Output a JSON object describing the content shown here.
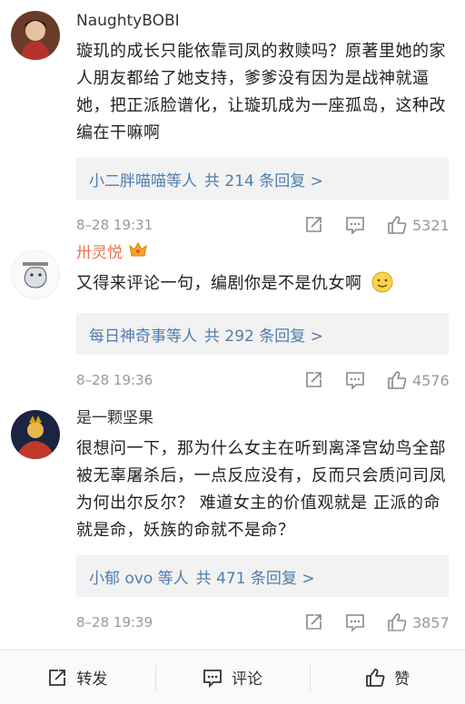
{
  "comments": [
    {
      "username": "NaughtyBOBI",
      "text": "璇玑的成长只能依靠司凤的救赎吗？原著里她的家人朋友都给了她支持，爹爹没有因为是战神就逼她，把正派脸谱化，让璇玑成为一座孤岛，这种改编在干嘛啊",
      "replies_who": "小二胖喵喵等人",
      "replies_count": "共 214 条回复 >",
      "date": "8–28 19:31",
      "likes": "5321"
    },
    {
      "username": "卅灵悦",
      "text": "又得来评论一句，编剧你是不是仇女啊",
      "replies_who": "每日神奇事等人",
      "replies_count": "共 292 条回复 >",
      "date": "8–28 19:36",
      "likes": "4576"
    },
    {
      "username": "是一颗坚果",
      "text": "很想问一下，那为什么女主在听到离泽宫幼鸟全部被无辜屠杀后，一点反应没有，反而只会质问司凤为何出尔反尔？ 难道女主的价值观就是 正派的命就是命，妖族的命就不是命？",
      "replies_who": "小郁 ovo 等人",
      "replies_count": "共 471 条回复 >",
      "date": "8–28 19:39",
      "likes": "3857"
    }
  ],
  "toolbar": {
    "repost": "转发",
    "comment": "评论",
    "like": "赞"
  },
  "colors": {
    "link": "#507daf",
    "vip_name": "#eb7350",
    "reply_bg": "#f2f2f2"
  }
}
